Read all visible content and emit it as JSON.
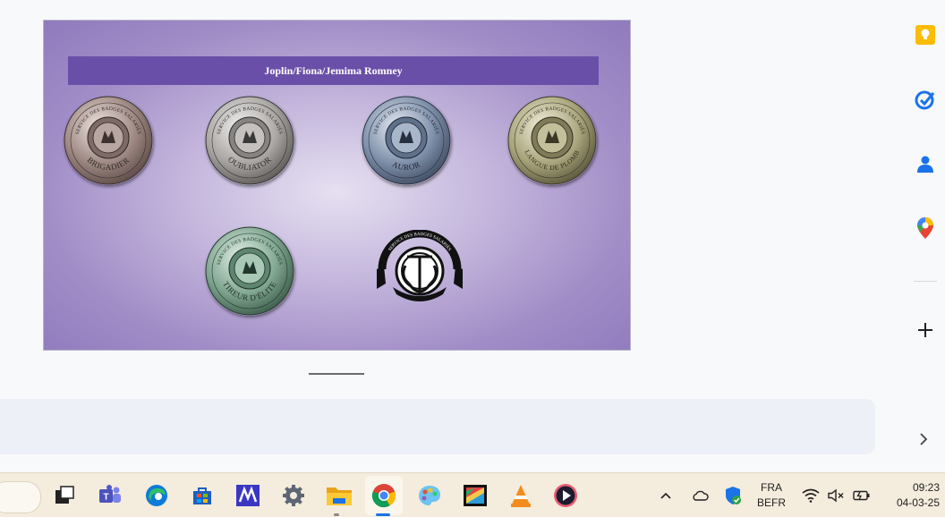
{
  "slide": {
    "banner_title": "Joplin/Fiona/Jemima Romney",
    "coins": [
      {
        "id": "brigadier",
        "label": "BRIGADIER",
        "ring": "SERVICE DES BADGES SALARIÉS",
        "color": "#9d8782"
      },
      {
        "id": "oubliator",
        "label": "OUBLIATOR",
        "ring": "SERVICE DES BADGES SALARIÉS",
        "color": "#a9a5a2"
      },
      {
        "id": "auror",
        "label": "AUROR",
        "ring": "SERVICE DES BADGES SALARIÉS",
        "color": "#7d8fa9"
      },
      {
        "id": "langue-de-plomb",
        "label": "LANGUE DE PLOMB",
        "ring": "SERVICE DES BADGES SALARIÉS",
        "color": "#a8a47c"
      },
      {
        "id": "tireur-d-elite",
        "label": "TIREUR D'ÉLITE",
        "ring": "SERVICE DES BADGES SALARIÉS",
        "color": "#7fa58f"
      }
    ],
    "emblem_ring": "SERVICE DES BADGES SALARIÉS"
  },
  "side_panel": {
    "icons": [
      "keep-icon",
      "tasks-icon",
      "contacts-icon",
      "maps-icon",
      "add-icon"
    ],
    "colors": {
      "keep": "#fbbc04",
      "tasks": "#1a73e8",
      "contacts": "#1a73e8"
    }
  },
  "taskbar": {
    "apps": [
      "task-view",
      "teams",
      "edge",
      "store",
      "app-m",
      "settings",
      "file-explorer",
      "chrome",
      "paint",
      "video-editor",
      "vlc",
      "media-player"
    ],
    "tray": {
      "lang_top": "FRA",
      "lang_bottom": "BEFR",
      "time": "09:23",
      "date": "04-03-25"
    }
  }
}
